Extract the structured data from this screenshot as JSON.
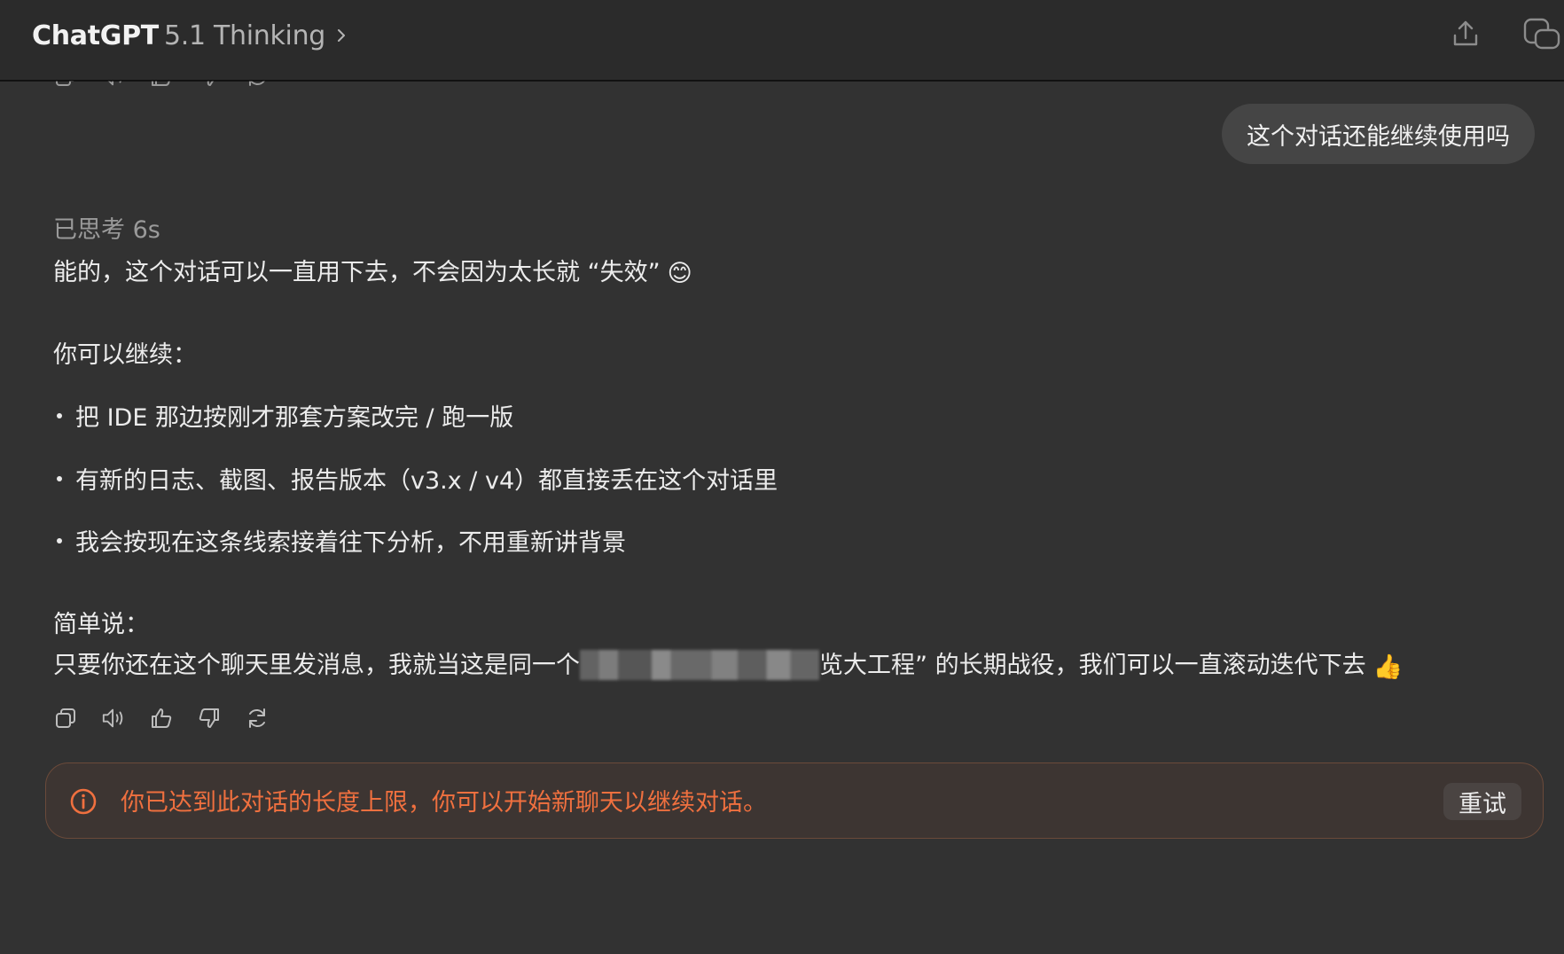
{
  "header": {
    "brand": "ChatGPT",
    "model": "5.1 Thinking",
    "icons": [
      "chevron-right-icon",
      "share-icon",
      "new-chat-icon"
    ]
  },
  "conversation": {
    "user_message": "这个对话还能继续使用吗",
    "thinking_label": "已思考 6s",
    "reply_intro": "能的，这个对话可以一直用下去，不会因为太长就 “失效”",
    "intro_emoji": "😊",
    "list_heading": "你可以继续：",
    "bullets": [
      "把 IDE 那边按刚才那套方案改完 / 跑一版",
      "有新的日志、截图、报告版本（v3.x / v4）都直接丢在这个对话里",
      "我会按现在这条线索接着往下分析，不用重新讲背景"
    ],
    "summary_heading": "简单说：",
    "summary_before": "只要你还在这个聊天里发消息，我就当这是同一个",
    "summary_after": "览大工程” 的长期战役，我们可以一直滚动迭代下去",
    "summary_emoji": "👍"
  },
  "message_actions": [
    "copy-icon",
    "read-aloud-icon",
    "thumbs-up-icon",
    "thumbs-down-icon",
    "regenerate-icon"
  ],
  "limit_banner": {
    "message": "你已达到此对话的长度上限，你可以开始新聊天以继续对话。",
    "retry_label": "重试"
  },
  "colors": {
    "background": "#323232",
    "header": "#2b2b2b",
    "user_bubble": "#454545",
    "warning_text": "#f0703f",
    "banner_border": "#6b4a3a"
  }
}
